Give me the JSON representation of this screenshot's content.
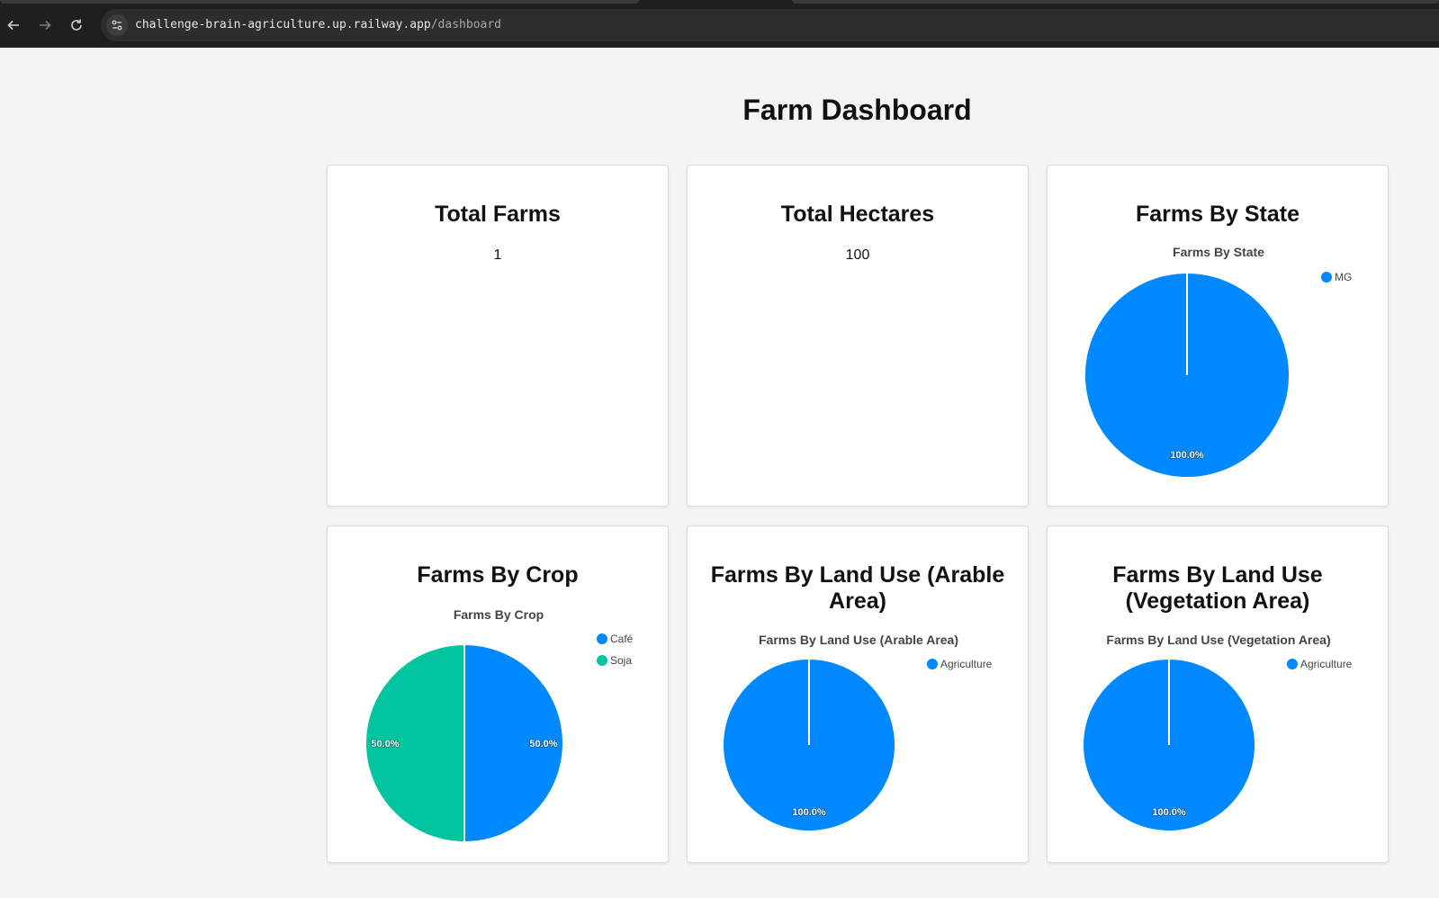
{
  "browser": {
    "url_host": "challenge-brain-agriculture.up.railway.app",
    "url_path": "/dashboard"
  },
  "page": {
    "title": "Farm Dashboard"
  },
  "cards": {
    "total_farms": {
      "title": "Total Farms",
      "value": "1"
    },
    "total_hectares": {
      "title": "Total Hectares",
      "value": "100"
    },
    "farms_by_state": {
      "title": "Farms By State"
    },
    "farms_by_crop": {
      "title": "Farms By Crop"
    },
    "farms_by_land_use_arable": {
      "title": "Farms By Land Use (Arable Area)"
    },
    "farms_by_land_use_vegetation": {
      "title": "Farms By Land Use (Vegetation Area)"
    }
  },
  "chart_data": [
    {
      "type": "pie",
      "title": "Farms By State",
      "categories": [
        "MG"
      ],
      "values": [
        1
      ],
      "labels": [
        "100.0%"
      ],
      "colors": [
        "#0088FE"
      ],
      "legend": "top-right"
    },
    {
      "type": "pie",
      "title": "Farms By Crop",
      "categories": [
        "Café",
        "Soja"
      ],
      "values": [
        1,
        1
      ],
      "labels": [
        "50.0%",
        "50.0%"
      ],
      "colors": [
        "#0088FE",
        "#00C49F"
      ],
      "legend": "top-right"
    },
    {
      "type": "pie",
      "title": "Farms By Land Use (Arable Area)",
      "categories": [
        "Agriculture"
      ],
      "values": [
        1
      ],
      "labels": [
        "100.0%"
      ],
      "colors": [
        "#0088FE"
      ],
      "legend": "top-right"
    },
    {
      "type": "pie",
      "title": "Farms By Land Use (Vegetation Area)",
      "categories": [
        "Agriculture"
      ],
      "values": [
        1
      ],
      "labels": [
        "100.0%"
      ],
      "colors": [
        "#0088FE"
      ],
      "legend": "top-right"
    }
  ]
}
